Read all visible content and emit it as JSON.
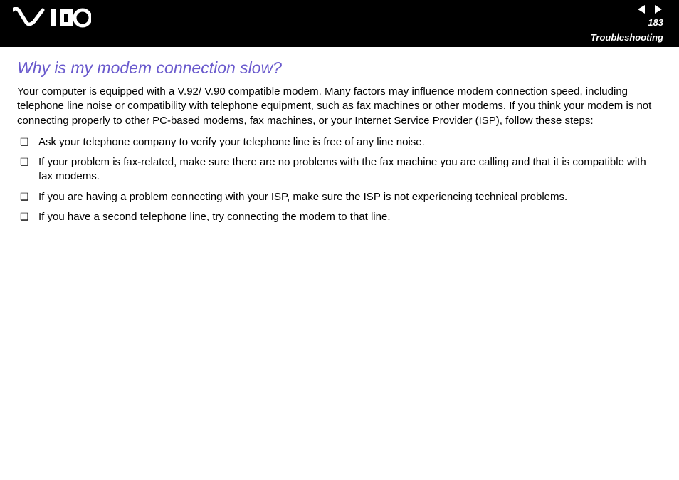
{
  "header": {
    "page_number": "183",
    "section": "Troubleshooting"
  },
  "content": {
    "heading": "Why is my modem connection slow?",
    "intro": "Your computer is equipped with a V.92/ V.90 compatible modem. Many factors may influence modem connection speed, including telephone line noise or compatibility with telephone equipment, such as fax machines or other modems. If you think your modem is not connecting properly to other PC-based modems, fax machines, or your Internet Service Provider (ISP), follow these steps:",
    "steps": [
      "Ask your telephone company to verify your telephone line is free of any line noise.",
      "If your problem is fax-related, make sure there are no problems with the fax machine you are calling and that it is compatible with fax modems.",
      "If you are having a problem connecting with your ISP, make sure the ISP is not experiencing technical problems.",
      "If you have a second telephone line, try connecting the modem to that line."
    ]
  }
}
